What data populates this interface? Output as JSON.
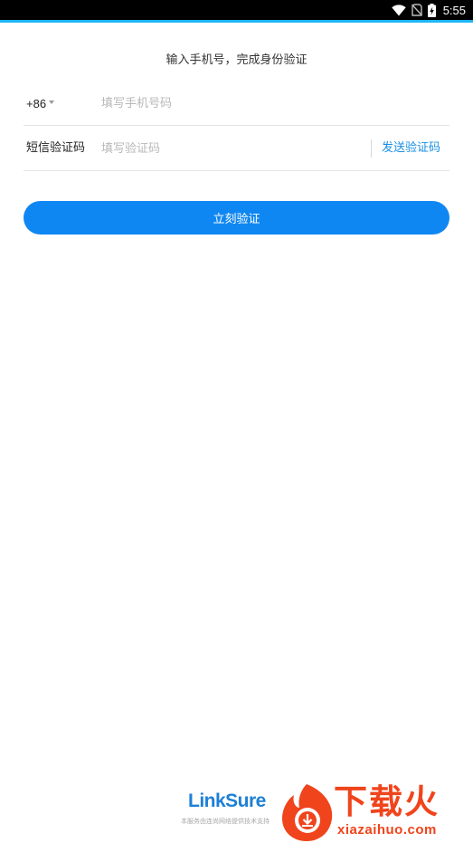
{
  "status_bar": {
    "time": "5:55",
    "icons": [
      "wifi-icon",
      "no-sim-icon",
      "battery-charging-icon"
    ],
    "accent_color": "#1fb6f4"
  },
  "page": {
    "subtitle": "输入手机号，完成身份验证"
  },
  "phone_row": {
    "country_code": "+86",
    "placeholder": "填写手机号码",
    "value": ""
  },
  "sms_row": {
    "label": "短信验证码",
    "placeholder": "填写验证码",
    "value": "",
    "send_code_label": "发送验证码"
  },
  "verify_button": {
    "label": "立刻验证",
    "color": "#0f87f2"
  },
  "footer": {
    "brand_link": "Link",
    "brand_sure": "Sure",
    "note": "本服务由连尚网络提供技术支持"
  },
  "watermark": {
    "title": "下载火",
    "domain": "xiazaihuo.com",
    "color": "#f0441c"
  }
}
